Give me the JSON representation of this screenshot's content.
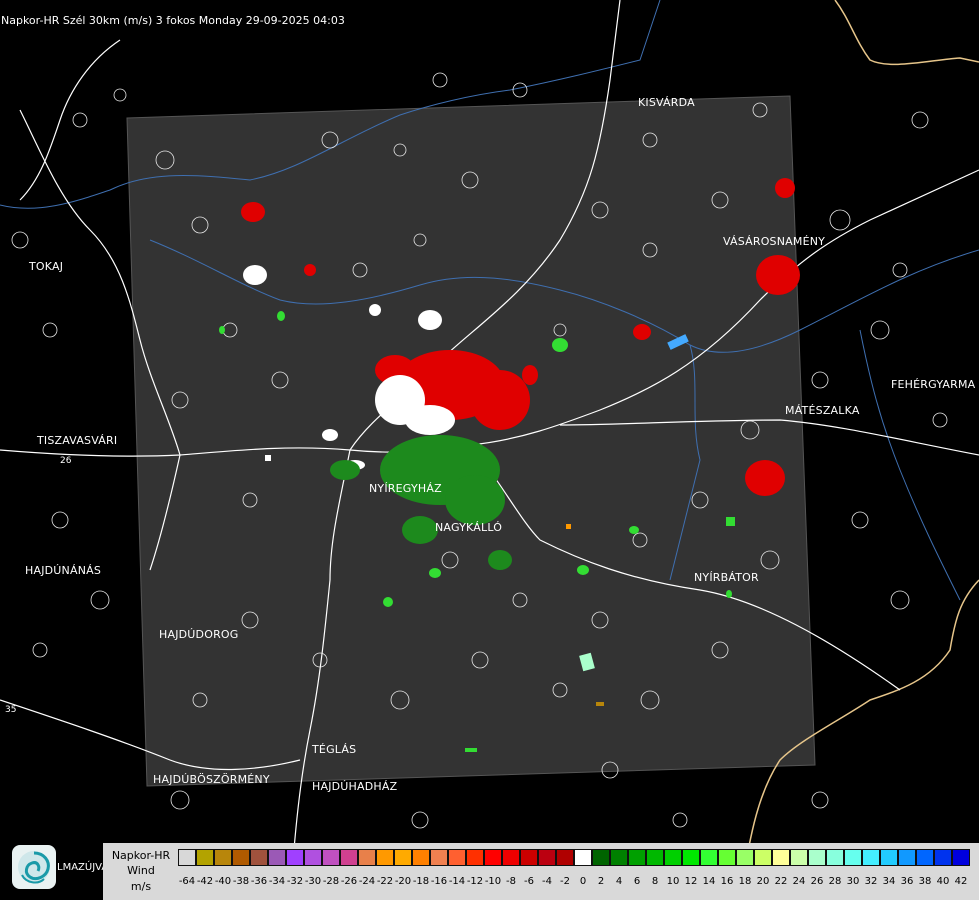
{
  "header": {
    "title": "Napkor-HR Szél 30km (m/s) 3 fokos Monday 29-09-2025 04:03"
  },
  "cities": [
    {
      "id": "kisvarda",
      "name": "KISVÁRDA"
    },
    {
      "id": "tokaj",
      "name": "TOKAJ"
    },
    {
      "id": "vasarosnameny",
      "name": "VÁSÁROSNAMÉNY"
    },
    {
      "id": "fehergyarmat",
      "name": "FEHÉRGYARMA"
    },
    {
      "id": "mateszalka",
      "name": "MÁTÉSZALKA"
    },
    {
      "id": "tiszavasvari",
      "name": "TISZAVASVÁRI"
    },
    {
      "id": "nyiregyhaza",
      "name": "NYÍREGYHÁZ"
    },
    {
      "id": "nagykallo",
      "name": "NAGYKÁLLÓ"
    },
    {
      "id": "hajdunanas",
      "name": "HAJDÚNÁNÁS"
    },
    {
      "id": "nyirbator",
      "name": "NYÍRBÁTOR"
    },
    {
      "id": "hajdudorog",
      "name": "HAJDÚDOROG"
    },
    {
      "id": "teglas",
      "name": "TÉGLÁS"
    },
    {
      "id": "hajduboszormeny",
      "name": "HAJDÚBÖSZÖRMÉNY"
    },
    {
      "id": "hajduhadhaz",
      "name": "HAJDÚHADHÁZ"
    }
  ],
  "road_labels": [
    "26",
    "35"
  ],
  "logo": {
    "text": "LMAZÚJVÁR"
  },
  "legend": {
    "label_lines": [
      "Napkor-HR",
      "Wind",
      "m/s"
    ],
    "ticks": [
      "-64",
      "-42",
      "-40",
      "-38",
      "-36",
      "-34",
      "-32",
      "-30",
      "-28",
      "-26",
      "-24",
      "-22",
      "-20",
      "-18",
      "-16",
      "-14",
      "-12",
      "-10",
      "-8",
      "-6",
      "-4",
      "-2",
      "0",
      "2",
      "4",
      "6",
      "8",
      "10",
      "12",
      "14",
      "16",
      "18",
      "20",
      "22",
      "24",
      "26",
      "28",
      "30",
      "32",
      "34",
      "36",
      "38",
      "40",
      "42"
    ],
    "colors": [
      "#d8d8d8",
      "#b3a300",
      "#b8860b",
      "#b05a00",
      "#a0523d",
      "#9b59b6",
      "#a040ff",
      "#b050e0",
      "#c050c0",
      "#d04090",
      "#e8804a",
      "#ff9900",
      "#ffaa00",
      "#ff8000",
      "#f08050",
      "#ff6030",
      "#ff3000",
      "#ff0000",
      "#ee0000",
      "#cc0000",
      "#bb0010",
      "#b00000",
      "#ffffff",
      "#006400",
      "#008000",
      "#00a000",
      "#00b800",
      "#00d000",
      "#00e800",
      "#33ff33",
      "#66ff33",
      "#99ff66",
      "#ccff66",
      "#ffff99",
      "#ccffaa",
      "#aaffcc",
      "#88ffdd",
      "#66ffee",
      "#44eeff",
      "#22ccff",
      "#1199ff",
      "#0066ff",
      "#0033ee",
      "#0000dd"
    ]
  }
}
